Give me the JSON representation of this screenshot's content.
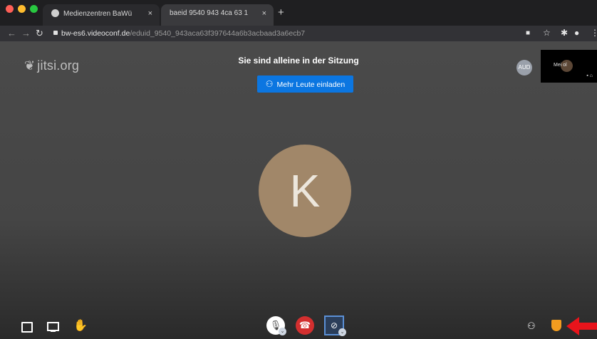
{
  "browser": {
    "tabs": [
      {
        "label": "Medienzentren BaWü"
      },
      {
        "label": "baeid 9540 943 4ca 63 1"
      }
    ],
    "new_tab_symbol": "+",
    "close_symbol": "×",
    "url_domain": "bw-es6.videoconf.de",
    "url_path": "/eduid_9540_943aca63f397644a6b3acbaad3a6ecb7"
  },
  "meeting": {
    "logo_text": "jitsi.org",
    "alone_message": "Sie sind alleine in der Sitzung",
    "invite_button": "Mehr Leute einladen",
    "aud_avatar": "AUD",
    "thumbnail_name": "Mei   ol",
    "participant_initial": "K"
  },
  "colors": {
    "invite_blue": "#0b76e1",
    "hangup_red": "#d32f2f",
    "avatar_brown": "#a18769",
    "shield_orange": "#f39c1f",
    "arrow_red": "#e8141b"
  },
  "icons": {
    "chat": "chat-icon",
    "screenshare": "screenshare-icon",
    "raise_hand": "raise-hand-icon",
    "mic": "microphone-icon",
    "hangup": "hangup-icon",
    "camera": "camera-off-icon",
    "participants": "participants-icon",
    "security": "shield-icon"
  }
}
